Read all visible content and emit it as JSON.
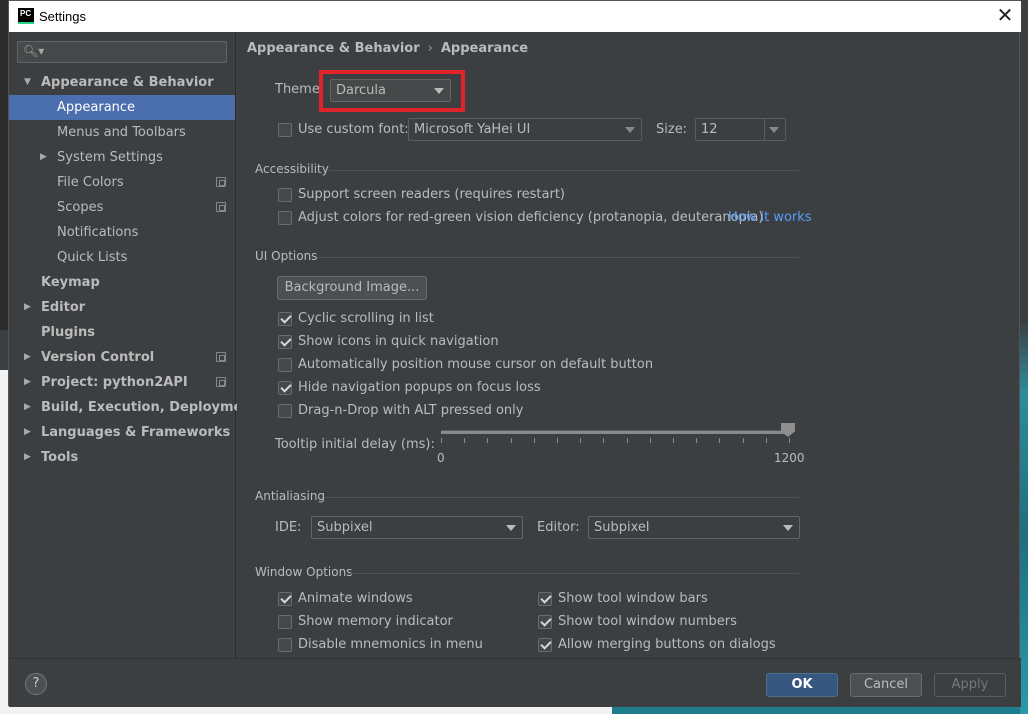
{
  "window": {
    "title": "Settings",
    "app_icon": "PC"
  },
  "search": {
    "placeholder": ""
  },
  "sidebar": {
    "items": [
      {
        "label": "Appearance & Behavior",
        "expanded": true
      },
      {
        "label": "Appearance",
        "selected": true
      },
      {
        "label": "Menus and Toolbars"
      },
      {
        "label": "System Settings",
        "expandable": true
      },
      {
        "label": "File Colors",
        "project": true
      },
      {
        "label": "Scopes",
        "project": true
      },
      {
        "label": "Notifications"
      },
      {
        "label": "Quick Lists"
      },
      {
        "label": "Keymap"
      },
      {
        "label": "Editor",
        "expandable": true
      },
      {
        "label": "Plugins"
      },
      {
        "label": "Version Control",
        "expandable": true,
        "project": true
      },
      {
        "label": "Project: python2API",
        "expandable": true,
        "project": true
      },
      {
        "label": "Build, Execution, Deployment",
        "expandable": true
      },
      {
        "label": "Languages & Frameworks",
        "expandable": true
      },
      {
        "label": "Tools",
        "expandable": true
      }
    ]
  },
  "breadcrumb": {
    "parent": "Appearance & Behavior",
    "separator": "›",
    "current": "Appearance"
  },
  "theme": {
    "label": "Theme:",
    "value": "Darcula"
  },
  "custom_font": {
    "label": "Use custom font:",
    "checked": false,
    "font": "Microsoft YaHei UI",
    "size_label": "Size:",
    "size": "12"
  },
  "accessibility": {
    "title": "Accessibility",
    "screen_readers": {
      "label": "Support screen readers (requires restart)",
      "checked": false
    },
    "color_adjust": {
      "label": "Adjust colors for red-green vision deficiency (protanopia, deuteranopia)",
      "checked": false
    },
    "link": "How it works"
  },
  "ui_options": {
    "title": "UI Options",
    "background_button": "Background Image...",
    "options": [
      {
        "label": "Cyclic scrolling in list",
        "checked": true
      },
      {
        "label": "Show icons in quick navigation",
        "checked": true
      },
      {
        "label": "Automatically position mouse cursor on default button",
        "checked": false
      },
      {
        "label": "Hide navigation popups on focus loss",
        "checked": true
      },
      {
        "label": "Drag-n-Drop with ALT pressed only",
        "checked": false
      }
    ],
    "tooltip": {
      "label": "Tooltip initial delay (ms):",
      "min": "0",
      "max": "1200",
      "value": 1200
    }
  },
  "antialiasing": {
    "title": "Antialiasing",
    "ide_label": "IDE:",
    "ide_value": "Subpixel",
    "editor_label": "Editor:",
    "editor_value": "Subpixel"
  },
  "window_options": {
    "title": "Window Options",
    "left": [
      {
        "label": "Animate windows",
        "checked": true
      },
      {
        "label": "Show memory indicator",
        "checked": false
      },
      {
        "label": "Disable mnemonics in menu",
        "checked": false
      }
    ],
    "right": [
      {
        "label": "Show tool window bars",
        "checked": true
      },
      {
        "label": "Show tool window numbers",
        "checked": true
      },
      {
        "label": "Allow merging buttons on dialogs",
        "checked": true
      }
    ]
  },
  "footer": {
    "help": "?",
    "ok": "OK",
    "cancel": "Cancel",
    "apply": "Apply"
  },
  "colors": {
    "accent": "#4b6eaf",
    "link": "#589df6",
    "highlight": "#e0242c",
    "ok_button": "#365880"
  }
}
